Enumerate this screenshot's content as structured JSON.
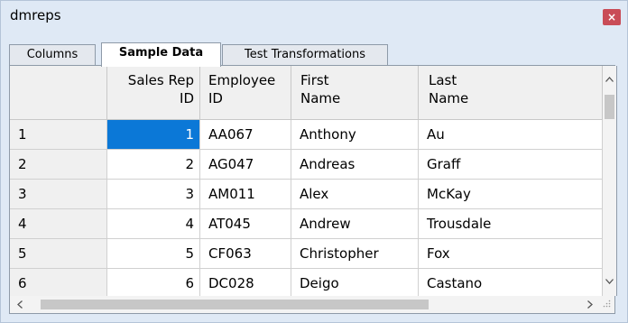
{
  "window": {
    "title": "dmreps",
    "close_glyph": "×"
  },
  "tabs": [
    {
      "label": "Columns",
      "active": false
    },
    {
      "label": "Sample Data",
      "active": true
    },
    {
      "label": "Test Transformations",
      "active": false
    }
  ],
  "grid": {
    "columns": [
      {
        "line1": "Sales Rep",
        "line2": "ID"
      },
      {
        "line1": "Employee",
        "line2": "ID"
      },
      {
        "line1": "First",
        "line2": "Name"
      },
      {
        "line1": "Last",
        "line2": "Name"
      }
    ],
    "rows": [
      {
        "row": "1",
        "sales_rep_id": "1",
        "employee_id": "AA067",
        "first": "Anthony",
        "last": "Au"
      },
      {
        "row": "2",
        "sales_rep_id": "2",
        "employee_id": "AG047",
        "first": "Andreas",
        "last": "Graff"
      },
      {
        "row": "3",
        "sales_rep_id": "3",
        "employee_id": "AM011",
        "first": "Alex",
        "last": "McKay"
      },
      {
        "row": "4",
        "sales_rep_id": "4",
        "employee_id": "AT045",
        "first": "Andrew",
        "last": "Trousdale"
      },
      {
        "row": "5",
        "sales_rep_id": "5",
        "employee_id": "CF063",
        "first": "Christopher",
        "last": "Fox"
      },
      {
        "row": "6",
        "sales_rep_id": "6",
        "employee_id": "DC028",
        "first": "Deigo",
        "last": "Castano"
      }
    ],
    "selected_cell_color": "#0b78d7"
  },
  "icons": {
    "scroll_up": "chevron-up-icon",
    "scroll_down": "chevron-down-icon",
    "scroll_left": "chevron-left-icon",
    "scroll_right": "chevron-right-icon"
  },
  "colors": {
    "window_bg": "#dfe9f5",
    "close_btn": "#c94c57"
  }
}
